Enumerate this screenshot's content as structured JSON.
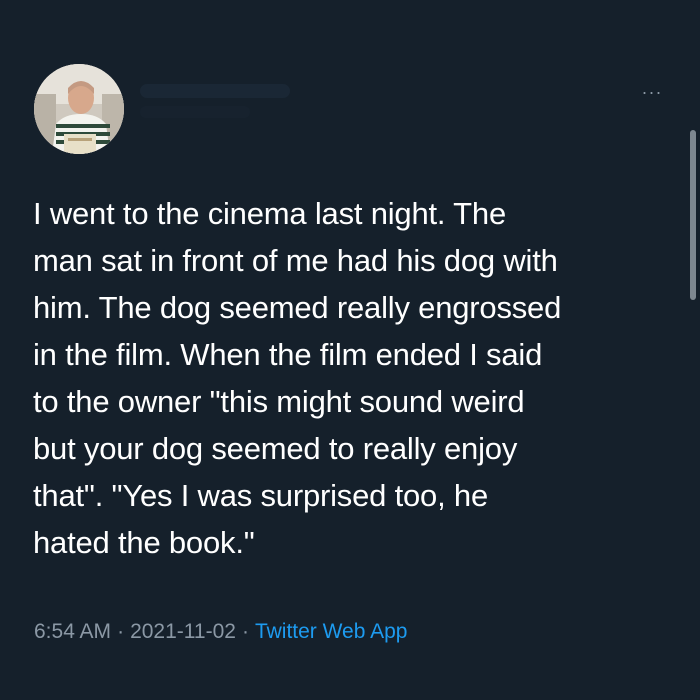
{
  "tweet": {
    "avatar_icon": "user-avatar",
    "more_icon": "more-options-icon",
    "more_label": "···",
    "text": "I went to the cinema last night. The\nman sat in front of me had his dog with\nhim. The dog seemed really engrossed\nin the film. When the film ended I said\nto the owner \"this might sound weird\nbut your dog seemed to really enjoy\nthat\". \"Yes I was surprised too, he\nhated the book.\"",
    "time": "6:54 AM",
    "separator": "·",
    "date": "2021-11-02",
    "source": "Twitter Web App"
  },
  "colors": {
    "background": "#15202b",
    "text": "#ffffff",
    "meta": "#8b98a5",
    "link": "#1d9bf0"
  }
}
